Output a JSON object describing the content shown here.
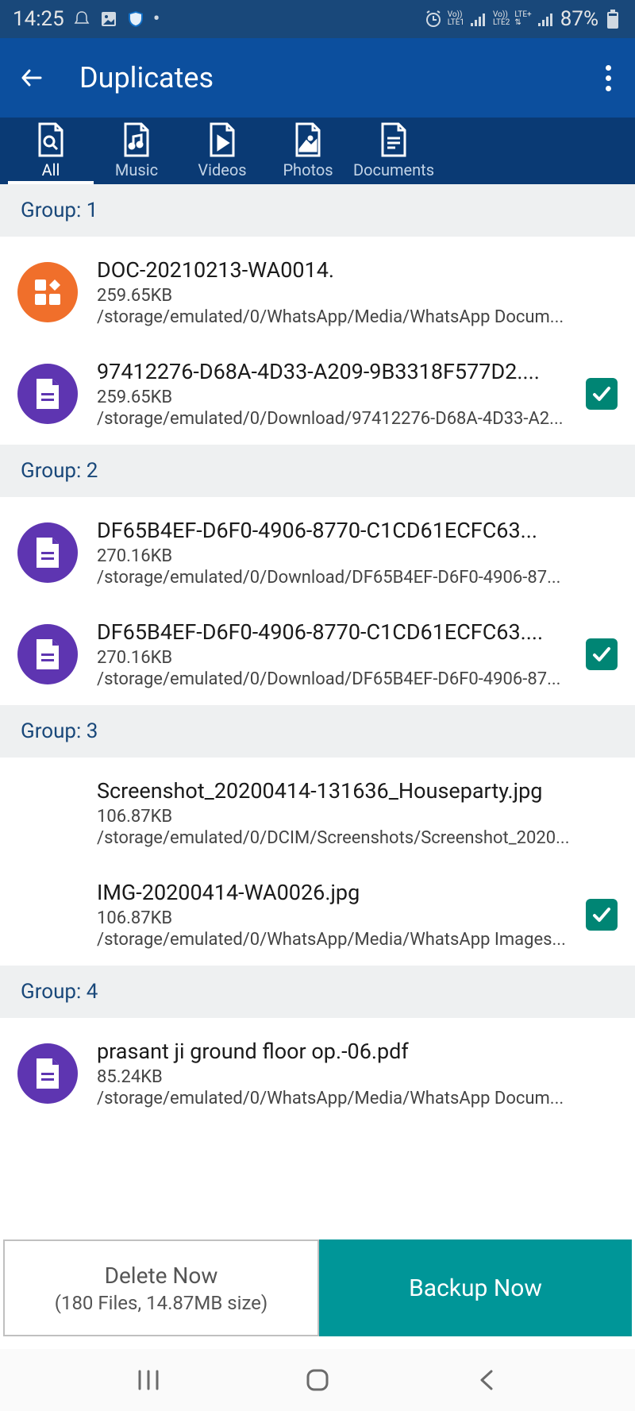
{
  "status": {
    "time": "14:25",
    "battery": "87%"
  },
  "appbar": {
    "title": "Duplicates"
  },
  "tabs": {
    "all": "All",
    "music": "Music",
    "videos": "Videos",
    "photos": "Photos",
    "documents": "Documents"
  },
  "groups": [
    {
      "label": "Group: 1",
      "files": [
        {
          "name": "DOC-20210213-WA0014.",
          "size": "259.65KB",
          "path": "/storage/emulated/0/WhatsApp/Media/WhatsApp Docum...",
          "icon": "orange",
          "checked": false
        },
        {
          "name": "97412276-D68A-4D33-A209-9B3318F577D2....",
          "size": "259.65KB",
          "path": "/storage/emulated/0/Download/97412276-D68A-4D33-A2...",
          "icon": "purple",
          "checked": true
        }
      ]
    },
    {
      "label": "Group: 2",
      "files": [
        {
          "name": "DF65B4EF-D6F0-4906-8770-C1CD61ECFC63...",
          "size": "270.16KB",
          "path": "/storage/emulated/0/Download/DF65B4EF-D6F0-4906-87...",
          "icon": "purple",
          "checked": false
        },
        {
          "name": "DF65B4EF-D6F0-4906-8770-C1CD61ECFC63....",
          "size": "270.16KB",
          "path": "/storage/emulated/0/Download/DF65B4EF-D6F0-4906-87...",
          "icon": "purple",
          "checked": true
        }
      ]
    },
    {
      "label": "Group: 3",
      "files": [
        {
          "name": "Screenshot_20200414-131636_Houseparty.jpg",
          "size": "106.87KB",
          "path": "/storage/emulated/0/DCIM/Screenshots/Screenshot_2020...",
          "icon": "blank",
          "checked": false
        },
        {
          "name": "IMG-20200414-WA0026.jpg",
          "size": "106.87KB",
          "path": "/storage/emulated/0/WhatsApp/Media/WhatsApp Images...",
          "icon": "blank",
          "checked": true
        }
      ]
    },
    {
      "label": "Group: 4",
      "files": [
        {
          "name": "prasant ji ground floor op.-06.pdf",
          "size": "85.24KB",
          "path": "/storage/emulated/0/WhatsApp/Media/WhatsApp Docum...",
          "icon": "purple",
          "checked": false
        }
      ]
    }
  ],
  "bottom": {
    "delete_label": "Delete Now",
    "delete_sub": "(180 Files, 14.87MB size)",
    "backup_label": "Backup Now"
  }
}
